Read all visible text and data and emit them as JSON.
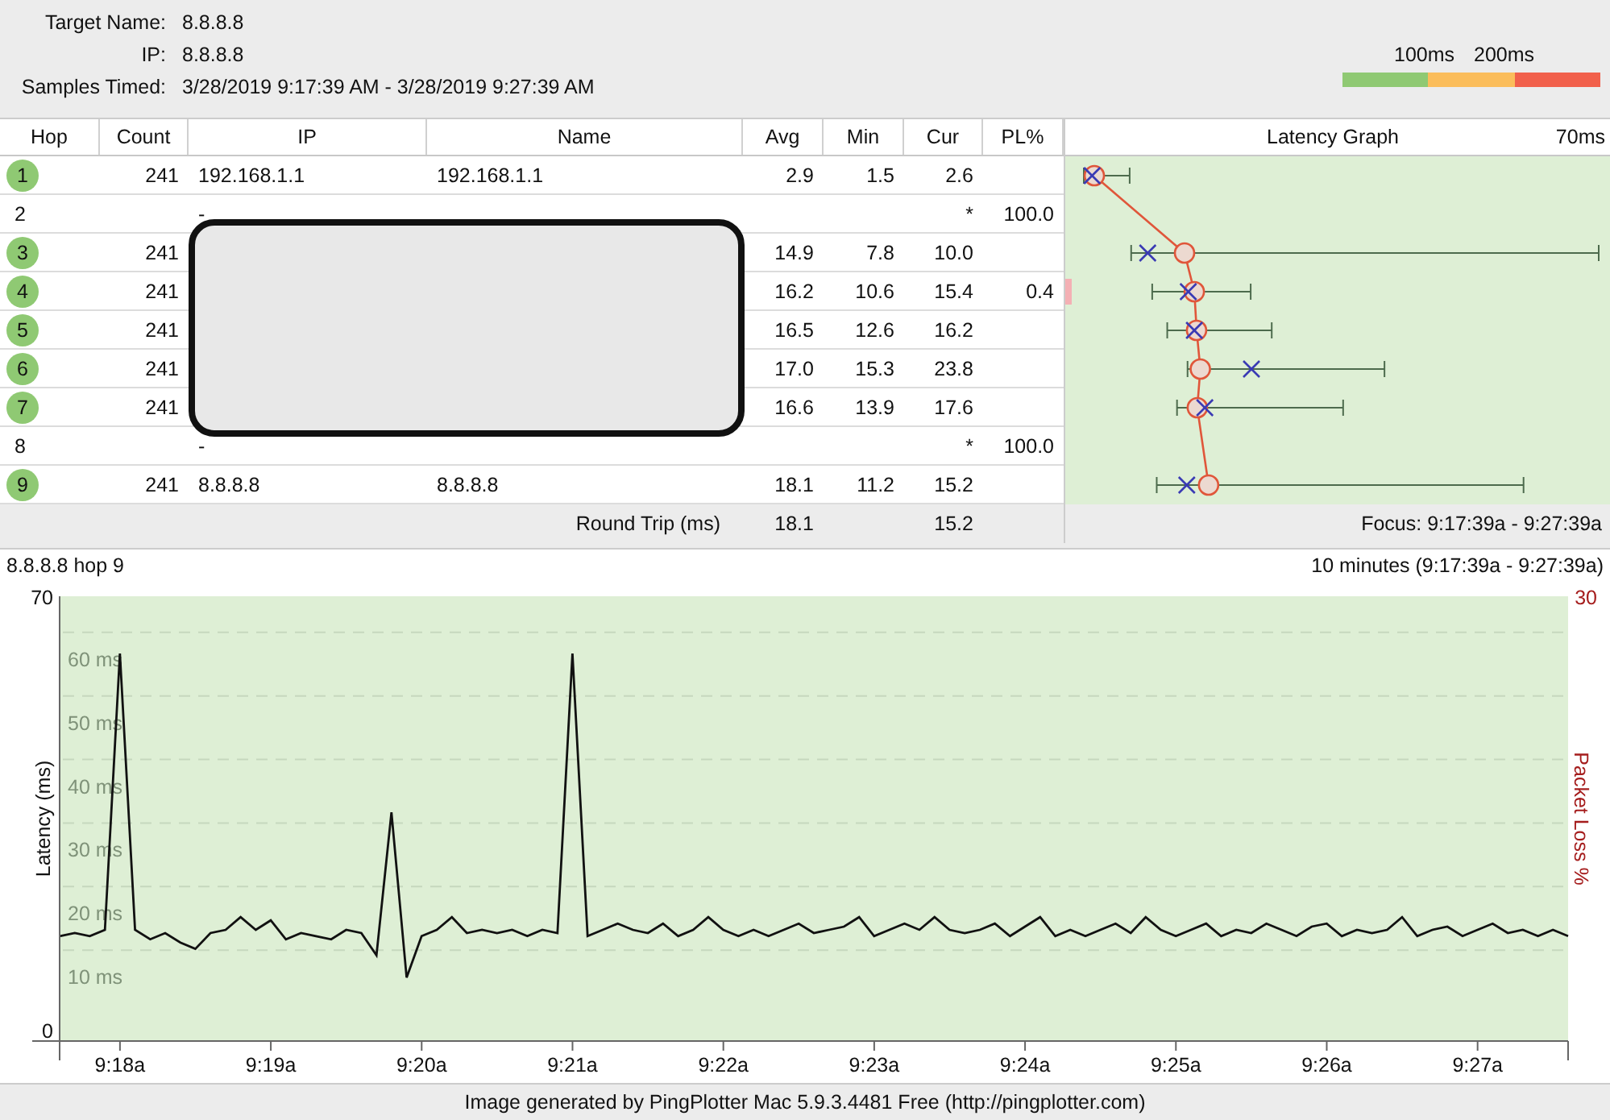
{
  "target": {
    "fields": [
      {
        "label": "Target Name:",
        "value": "8.8.8.8"
      },
      {
        "label": "IP:",
        "value": "8.8.8.8"
      },
      {
        "label": "Samples Timed:",
        "value": "3/28/2019 9:17:39 AM - 3/28/2019 9:27:39 AM"
      }
    ]
  },
  "legend": {
    "labels": [
      "100ms",
      "200ms"
    ],
    "segments": [
      {
        "color": "#8fc973"
      },
      {
        "color": "#fbbd5b"
      },
      {
        "color": "#f1604b"
      }
    ]
  },
  "table": {
    "columns": [
      "Hop",
      "Count",
      "IP",
      "Name",
      "Avg",
      "Min",
      "Cur",
      "PL%"
    ],
    "rows": [
      {
        "kind": "ok",
        "hop": "1",
        "count": "241",
        "ip": "192.168.1.1",
        "name": "192.168.1.1",
        "avg": "2.9",
        "min": "1.5",
        "cur": "2.6"
      },
      {
        "kind": "timeout",
        "hop": "2",
        "ip": "-",
        "cur": "*",
        "pl": "100.0"
      },
      {
        "kind": "ok",
        "hop": "3",
        "count": "241",
        "avg": "14.9",
        "min": "7.8",
        "cur": "10.0"
      },
      {
        "kind": "ok",
        "hop": "4",
        "count": "241",
        "avg": "16.2",
        "min": "10.6",
        "cur": "15.4",
        "pl": "0.4"
      },
      {
        "kind": "ok",
        "hop": "5",
        "count": "241",
        "avg": "16.5",
        "min": "12.6",
        "cur": "16.2"
      },
      {
        "kind": "ok",
        "hop": "6",
        "count": "241",
        "avg": "17.0",
        "min": "15.3",
        "cur": "23.8"
      },
      {
        "kind": "ok",
        "hop": "7",
        "count": "241",
        "avg": "16.6",
        "min": "13.9",
        "cur": "17.6"
      },
      {
        "kind": "timeout",
        "hop": "8",
        "ip": "-",
        "cur": "*",
        "pl": "100.0"
      },
      {
        "kind": "ok",
        "hop": "9",
        "count": "241",
        "ip": "8.8.8.8",
        "name": "8.8.8.8",
        "avg": "18.1",
        "min": "11.2",
        "cur": "15.2"
      }
    ],
    "round_trip": {
      "label": "Round Trip (ms)",
      "avg": "18.1",
      "cur": "15.2"
    }
  },
  "latency_graph": {
    "title": "Latency Graph",
    "scale_label": "70ms",
    "focus": "Focus: 9:17:39a - 9:27:39a"
  },
  "hop_chart": {
    "title": "8.8.8.8 hop 9",
    "range": "10 minutes (9:17:39a - 9:27:39a)",
    "axis_max_label": "70",
    "axis_min_label": "0",
    "loss_axis_max": "30",
    "loss_axis_label": "Packet Loss %",
    "chart_data": {
      "type": "line",
      "ylabel": "Latency (ms)",
      "ylim": [
        0,
        70
      ],
      "yticks": [
        {
          "value": 10,
          "label": "10 ms"
        },
        {
          "value": 20,
          "label": "20 ms"
        },
        {
          "value": 30,
          "label": "30 ms"
        },
        {
          "value": 40,
          "label": "40 ms"
        },
        {
          "value": 50,
          "label": "50 ms"
        },
        {
          "value": 60,
          "label": "60 ms"
        }
      ],
      "categories": [
        null,
        null,
        null,
        null,
        "9:18a",
        null,
        null,
        null,
        null,
        null,
        null,
        null,
        null,
        null,
        "9:19a",
        null,
        null,
        null,
        null,
        null,
        null,
        null,
        null,
        null,
        "9:20a",
        null,
        null,
        null,
        null,
        null,
        null,
        null,
        null,
        null,
        "9:21a",
        null,
        null,
        null,
        null,
        null,
        null,
        null,
        null,
        null,
        "9:22a",
        null,
        null,
        null,
        null,
        null,
        null,
        null,
        null,
        null,
        "9:23a",
        null,
        null,
        null,
        null,
        null,
        null,
        null,
        null,
        null,
        "9:24a",
        null,
        null,
        null,
        null,
        null,
        null,
        null,
        null,
        null,
        "9:25a",
        null,
        null,
        null,
        null,
        null,
        null,
        null,
        null,
        null,
        "9:26a",
        null,
        null,
        null,
        null,
        null,
        null,
        null,
        null,
        null,
        "9:27a",
        null,
        null,
        null,
        null,
        null,
        null
      ],
      "series": [
        {
          "color": "#111111",
          "values": [
            16.5,
            17,
            16.5,
            17.5,
            61,
            17.5,
            16,
            17,
            15.5,
            14.5,
            17,
            17.5,
            19.5,
            17.5,
            19,
            16,
            17,
            16.5,
            16,
            17.5,
            17,
            13.5,
            36,
            10,
            16.5,
            17.5,
            19.5,
            17,
            17.5,
            17,
            17.5,
            16.5,
            17.5,
            17,
            61,
            16.5,
            17.5,
            18.5,
            17.5,
            17,
            18.5,
            16.5,
            17.5,
            19.5,
            17.5,
            16.5,
            17.5,
            16.5,
            17.5,
            18.5,
            17,
            17.5,
            18,
            19.5,
            16.5,
            17.5,
            18.5,
            17.5,
            19.5,
            17.5,
            17,
            17.5,
            18.5,
            16.5,
            18,
            19.5,
            16.5,
            17.5,
            16.5,
            17.5,
            18.5,
            17,
            19.5,
            17.5,
            16.5,
            17.5,
            18.5,
            16.5,
            17.5,
            17,
            18.5,
            17.5,
            16.5,
            18,
            18.5,
            16.5,
            17.5,
            17,
            17.5,
            19.5,
            16.5,
            17.5,
            18,
            16.5,
            17.5,
            18.5,
            17,
            17.5,
            16.5,
            17.5,
            16.5
          ]
        }
      ]
    }
  },
  "footer": "Image generated by PingPlotter Mac 5.9.3.4481 Free (http://pingplotter.com)"
}
